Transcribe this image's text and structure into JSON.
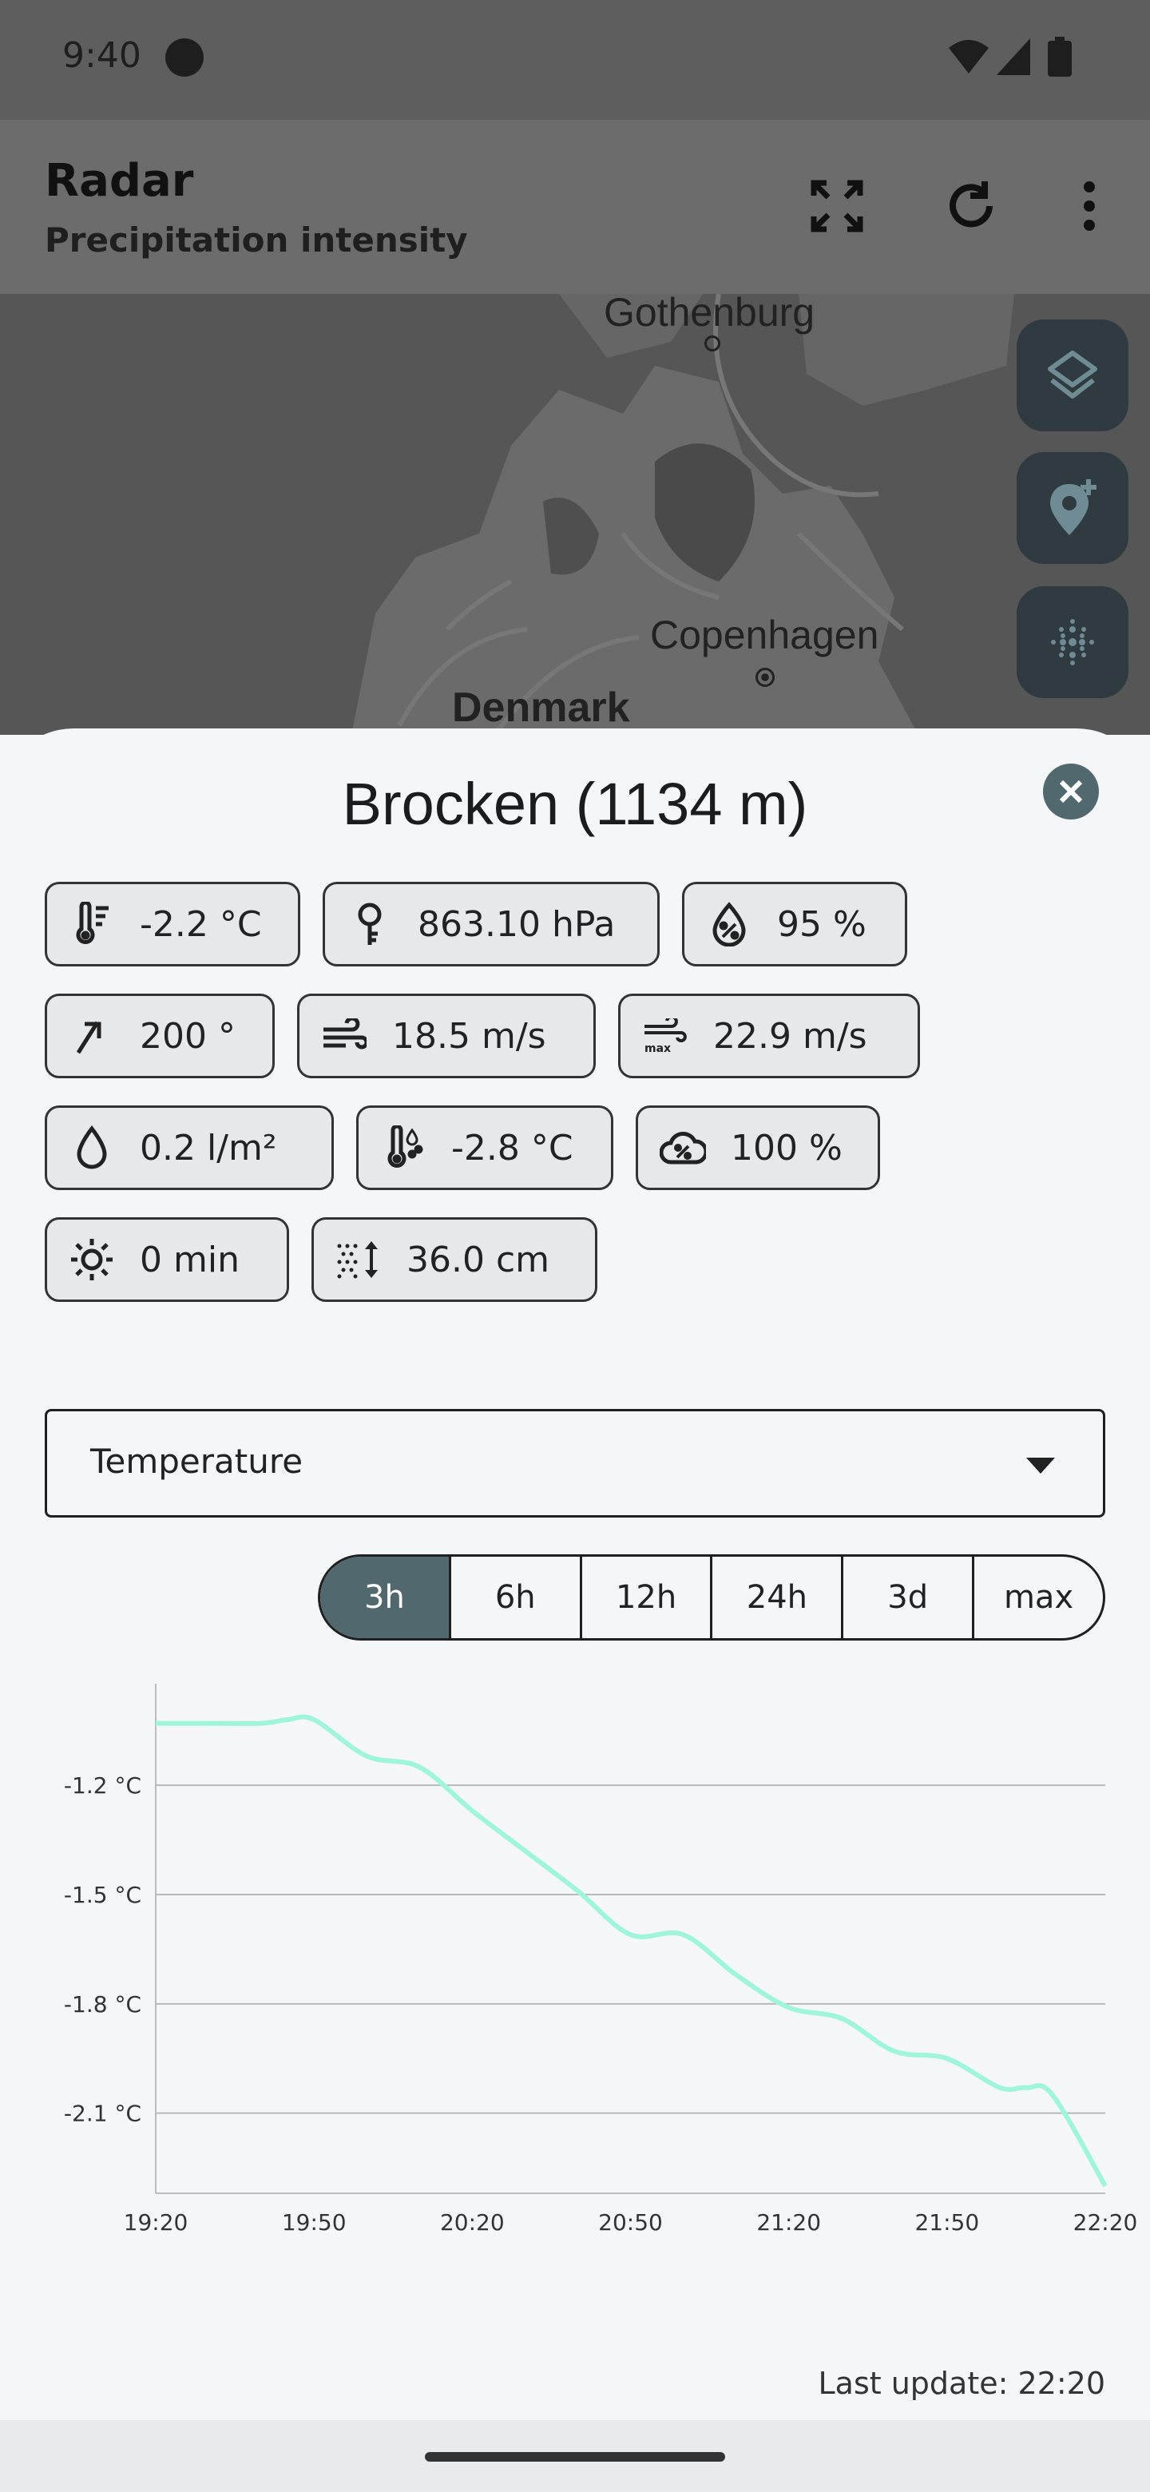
{
  "status": {
    "time": "9:40"
  },
  "appbar": {
    "title": "Radar",
    "subtitle": "Precipitation intensity"
  },
  "map": {
    "labels": [
      "Gothenburg",
      "Copenhagen",
      "Denmark"
    ]
  },
  "sheet": {
    "station": "Brocken (1134 m)",
    "chips": [
      {
        "icon": "thermometer-icon",
        "value": "-2.2 °C"
      },
      {
        "icon": "barometer-icon",
        "value": "863.10 hPa"
      },
      {
        "icon": "humidity-icon",
        "value": "95 %"
      },
      {
        "icon": "wind-direction-icon",
        "value": "200 °"
      },
      {
        "icon": "wind-icon",
        "value": "18.5 m/s"
      },
      {
        "icon": "wind-gust-icon",
        "value": "22.9 m/s"
      },
      {
        "icon": "precipitation-icon",
        "value": "0.2 l/m²"
      },
      {
        "icon": "dew-point-icon",
        "value": "-2.8 °C"
      },
      {
        "icon": "cloud-cover-icon",
        "value": "100 %"
      },
      {
        "icon": "sunshine-icon",
        "value": "0 min"
      },
      {
        "icon": "snow-depth-icon",
        "value": "36.0 cm"
      }
    ],
    "dropdown": {
      "selected": "Temperature"
    },
    "ranges": [
      "3h",
      "6h",
      "12h",
      "24h",
      "3d",
      "max"
    ],
    "active_range": "3h",
    "last_update": "Last update: 22:20"
  },
  "colors": {
    "accent": "#52686f",
    "line": "#9ff5d8"
  },
  "chart_data": {
    "type": "line",
    "x": [
      "19:20",
      "19:30",
      "19:40",
      "19:45",
      "19:50",
      "20:00",
      "20:10",
      "20:20",
      "20:30",
      "20:40",
      "20:50",
      "21:00",
      "21:10",
      "21:20",
      "21:30",
      "21:40",
      "21:50",
      "22:00",
      "22:05",
      "22:10",
      "22:20"
    ],
    "series": [
      {
        "values": [
          -1.03,
          -1.03,
          -1.03,
          -1.02,
          -1.02,
          -1.12,
          -1.15,
          -1.27,
          -1.38,
          -1.49,
          -1.61,
          -1.61,
          -1.72,
          -1.81,
          -1.84,
          -1.93,
          -1.95,
          -2.03,
          -2.03,
          -2.05,
          -2.3
        ]
      }
    ],
    "x_ticks": [
      "19:20",
      "19:50",
      "20:20",
      "20:50",
      "21:20",
      "21:50",
      "22:20"
    ],
    "y_ticks": [
      "-1.2 °C",
      "-1.5 °C",
      "-1.8 °C",
      "-2.1 °C"
    ],
    "y_tick_values": [
      -1.2,
      -1.5,
      -1.8,
      -2.1
    ],
    "ylim": [
      -2.32,
      -0.93
    ],
    "grid": "horizontal"
  }
}
